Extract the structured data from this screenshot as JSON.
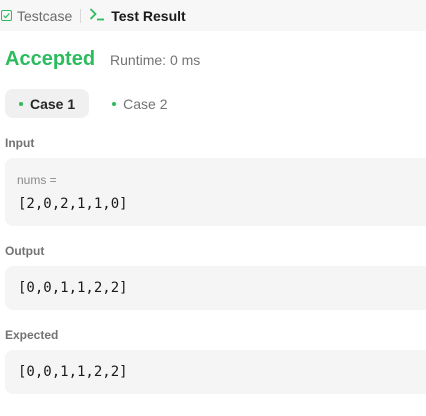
{
  "tabs": {
    "testcase_label": "Testcase",
    "result_label": "Test Result"
  },
  "result": {
    "status": "Accepted",
    "runtime": "Runtime: 0 ms",
    "status_color": "#2cbb5d"
  },
  "cases": [
    {
      "label": "Case 1",
      "active": true
    },
    {
      "label": "Case 2",
      "active": false
    }
  ],
  "input": {
    "label": "Input",
    "var_name": "nums =",
    "value": "[2,0,2,1,1,0]"
  },
  "output": {
    "label": "Output",
    "value": "[0,0,1,1,2,2]"
  },
  "expected": {
    "label": "Expected",
    "value": "[0,0,1,1,2,2]"
  }
}
